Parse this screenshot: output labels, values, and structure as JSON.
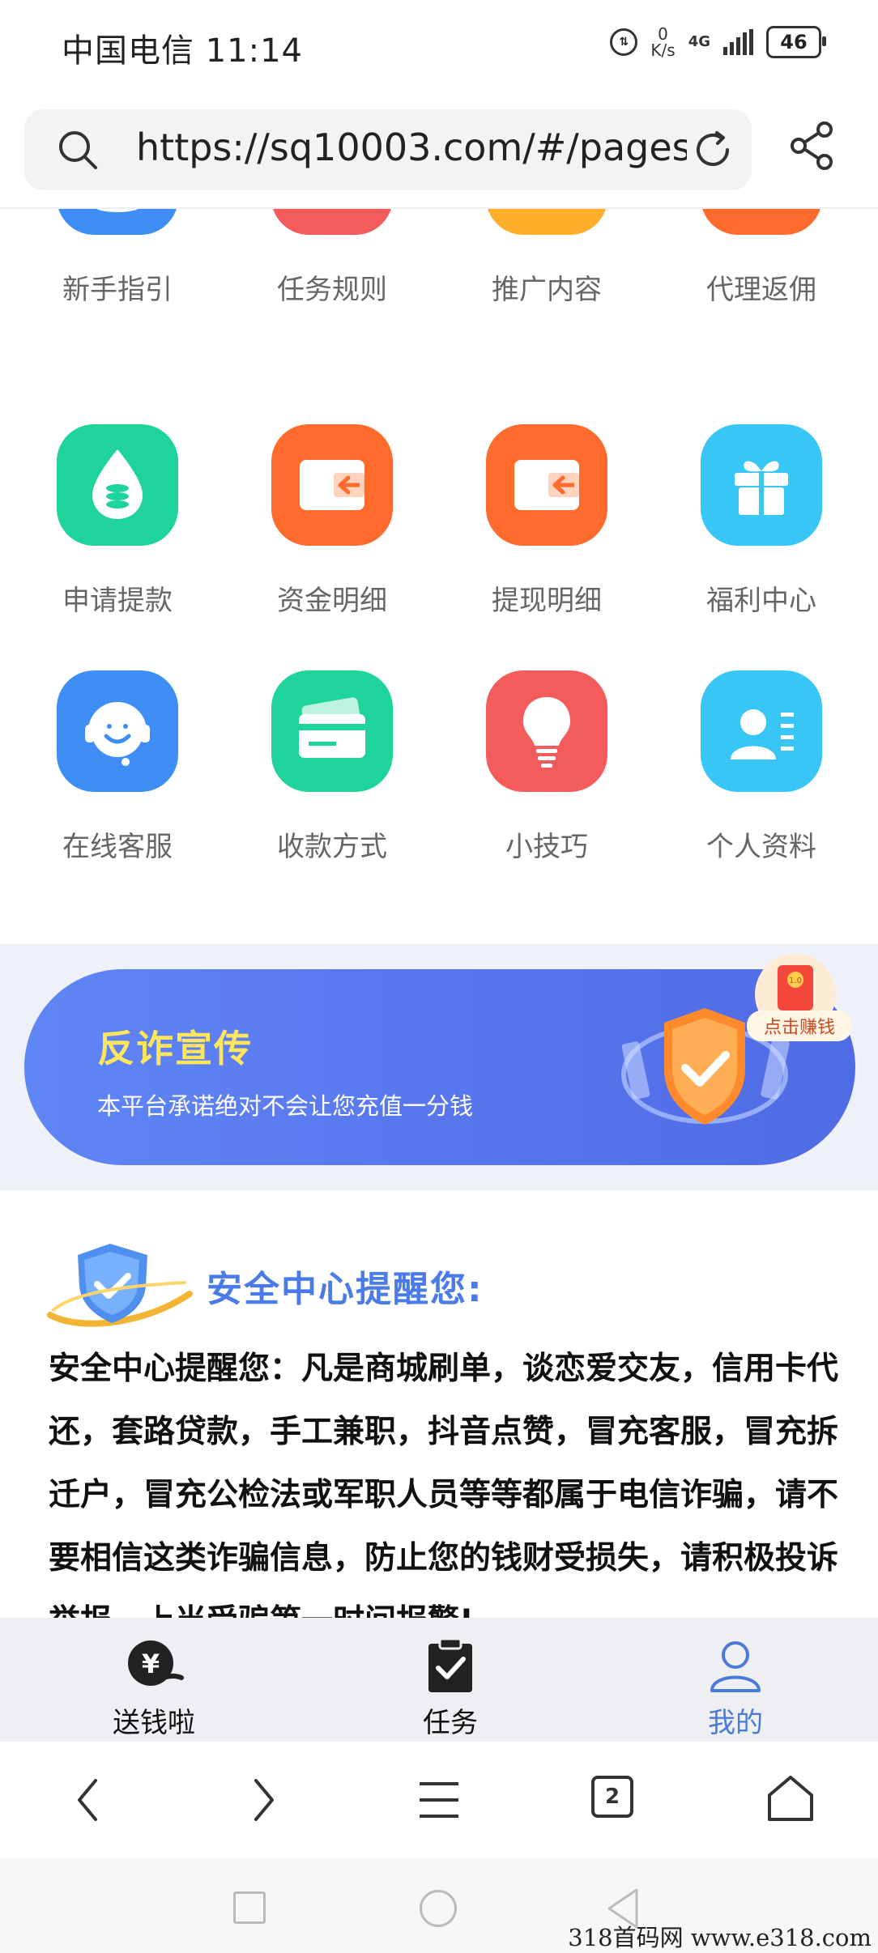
{
  "status_bar": {
    "carrier": "中国电信",
    "time": "11:14",
    "net_speed_value": "0",
    "net_speed_unit": "K/s",
    "network": "4G",
    "battery": "46"
  },
  "url_bar": {
    "url": "https://sq10003.com/#/pages"
  },
  "grid": {
    "row1": [
      {
        "label": "新手指引",
        "icon": "location-pin-icon",
        "color": "#3f8ef5"
      },
      {
        "label": "任务规则",
        "icon": "clipboard-icon",
        "color": "#f45b5b"
      },
      {
        "label": "推广内容",
        "icon": "pennant-icon",
        "color": "#ffae2b"
      },
      {
        "label": "代理返佣",
        "icon": "money-bag-icon",
        "color": "#ff6b2c"
      }
    ],
    "row2": [
      {
        "label": "申请提款",
        "icon": "coin-drop-icon",
        "color": "#1ed49b"
      },
      {
        "label": "资金明细",
        "icon": "wallet-icon",
        "color": "#ff6b2c"
      },
      {
        "label": "提现明细",
        "icon": "wallet-icon",
        "color": "#ff6b2c"
      },
      {
        "label": "福利中心",
        "icon": "gift-icon",
        "color": "#37c6f5"
      }
    ],
    "row3": [
      {
        "label": "在线客服",
        "icon": "headset-icon",
        "color": "#3f8ef5"
      },
      {
        "label": "收款方式",
        "icon": "card-icon",
        "color": "#1ed49b"
      },
      {
        "label": "小技巧",
        "icon": "bulb-icon",
        "color": "#f45b5b"
      },
      {
        "label": "个人资料",
        "icon": "profile-card-icon",
        "color": "#37c6f5"
      }
    ]
  },
  "banner": {
    "title": "反诈宣传",
    "subtitle": "本平台承诺绝对不会让您充值一分钱",
    "earn_badge": "点击赚钱",
    "earn_badge_icon_text": "1.0"
  },
  "security": {
    "title": "安全中心提醒您:",
    "body": "安全中心提醒您：凡是商城刷单，谈恋爱交友，信用卡代还，套路贷款，手工兼职，抖音点赞，冒充客服，冒充拆迁户，冒充公检法或军职人员等等都属于电信诈骗，请不要相信这类诈骗信息，防止您的钱财受损失，请积极投诉举报，上当受骗第一时间报警!"
  },
  "tabbar": {
    "tabs": [
      {
        "label": "送钱啦",
        "icon": "yen-hand-icon",
        "active": false
      },
      {
        "label": "任务",
        "icon": "task-clipboard-icon",
        "active": false
      },
      {
        "label": "我的",
        "icon": "user-icon",
        "active": true
      }
    ]
  },
  "browser_nav": {
    "tab_count": "2"
  },
  "watermark": "318首码网  www.e318.com",
  "colors": {
    "accent_blue": "#4a7bd8",
    "banner_title": "#ffe55a",
    "security_title": "#4a7be8"
  }
}
